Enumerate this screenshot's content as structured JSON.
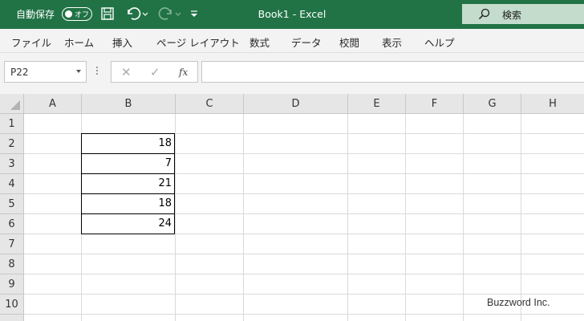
{
  "titlebar": {
    "autosave_label": "自動保存",
    "toggle_state": "オフ",
    "title": "Book1  -  Excel",
    "search_label": "検索",
    "accent_color": "#217346",
    "icons": [
      "save-icon",
      "undo-icon",
      "redo-icon",
      "customize-icon",
      "search-icon"
    ]
  },
  "menu": [
    "ファイル",
    "ホーム",
    "挿入",
    "ページ レイアウト",
    "数式",
    "データ",
    "校閲",
    "表示",
    "ヘルプ"
  ],
  "formula_bar": {
    "name_box": "P22",
    "fx_label": "fx",
    "formula": ""
  },
  "grid": {
    "columns": [
      "A",
      "B",
      "C",
      "D",
      "E",
      "F",
      "G",
      "H"
    ],
    "rows": [
      "1",
      "2",
      "3",
      "4",
      "5",
      "6",
      "7",
      "8",
      "9",
      "10"
    ],
    "cells": [
      {
        "ref": "B2",
        "value": "18"
      },
      {
        "ref": "B3",
        "value": "7"
      },
      {
        "ref": "B4",
        "value": "21"
      },
      {
        "ref": "B5",
        "value": "18"
      },
      {
        "ref": "B6",
        "value": "24"
      }
    ]
  },
  "watermark": "Buzzword Inc."
}
